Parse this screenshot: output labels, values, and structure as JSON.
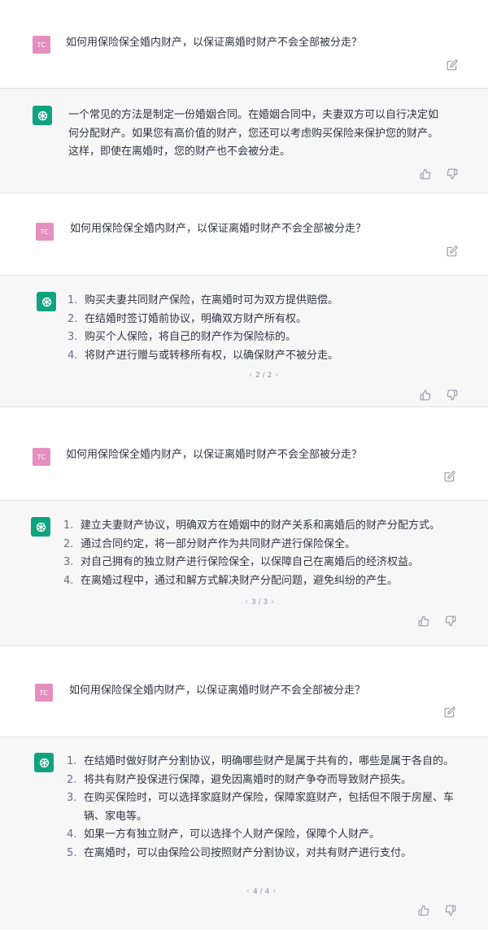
{
  "user_avatar_initials": "TC",
  "blocks": [
    {
      "question": "如何用保险保全婚内财产，以保证离婚时财产不会全部被分走？",
      "answer_lines": [
        "一个常见的方法是制定一份婚姻合同。在婚姻合同中，夫妻双方可以自行决定如",
        "何分配财产。如果您有高价值的财产，您还可以考虑购买保险来保护您的财产。",
        "这样，即使在离婚时，您的财产也不会被分走。"
      ]
    },
    {
      "question": "如何用保险保全婚内财产，以保证离婚时财产不会全部被分走？",
      "items": [
        {
          "num": "1.",
          "text": "购买夫妻共同财产保险，在离婚时可为双方提供赔偿。"
        },
        {
          "num": "2.",
          "text": "在结婚时签订婚前协议，明确双方财产所有权。"
        },
        {
          "num": "3.",
          "text": "购买个人保险，将自己的财产作为保险标的。"
        },
        {
          "num": "4.",
          "text": "将财产进行赠与或转移所有权，以确保财产不被分走。"
        }
      ],
      "pager": "2 / 2"
    },
    {
      "question": "如何用保险保全婚内财产，以保证离婚时财产不会全部被分走？",
      "items": [
        {
          "num": "1.",
          "text": "建立夫妻财产协议，明确双方在婚姻中的财产关系和离婚后的财产分配方式。"
        },
        {
          "num": "2.",
          "text": "通过合同约定，将一部分财产作为共同财产进行保险保全。"
        },
        {
          "num": "3.",
          "text": "对自己拥有的独立财产进行保险保全，以保障自己在离婚后的经济权益。"
        },
        {
          "num": "4.",
          "text": "在离婚过程中，通过和解方式解决财产分配问题，避免纠纷的产生。"
        }
      ],
      "pager": "3 / 3"
    },
    {
      "question": "如何用保险保全婚内财产，以保证离婚时财产不会全部被分走？",
      "items": [
        {
          "num": "1.",
          "text": "在结婚时做好财产分割协议，明确哪些财产是属于共有的，哪些是属于各自的。"
        },
        {
          "num": "2.",
          "text": "将共有财产投保进行保障，避免因离婚时的财产争夺而导致财产损失。"
        },
        {
          "num": "3.",
          "text": "在购买保险时，可以选择家庭财产保险，保障家庭财产，包括但不限于房屋、车辆、家电等。"
        },
        {
          "num": "4.",
          "text": "如果一方有独立财产，可以选择个人财产保险，保障个人财产。"
        },
        {
          "num": "5.",
          "text": "在离婚时，可以由保险公司按照财产分割协议，对共有财产进行支付。"
        }
      ],
      "pager": "4 / 4"
    }
  ]
}
